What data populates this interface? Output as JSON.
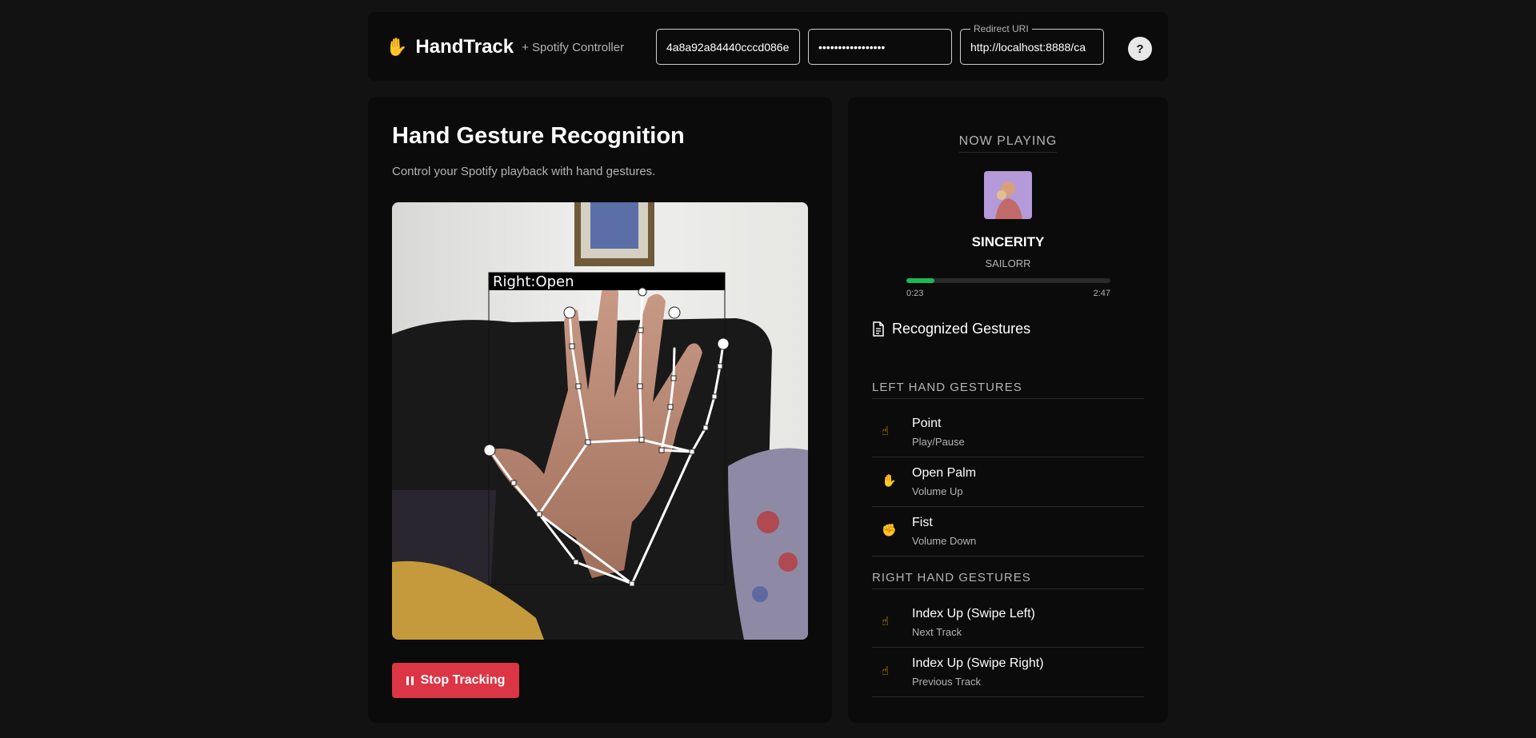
{
  "header": {
    "logo_icon": "✋",
    "title": "HandTrack",
    "subtitle": "+ Spotify Controller",
    "client_id_value": "4a8a92a84440cccd086e",
    "client_secret_value": "•••••••••••••••••",
    "redirect_label": "Redirect URI",
    "redirect_value": "http://localhost:8888/ca",
    "help_label": "?"
  },
  "main": {
    "title": "Hand Gesture Recognition",
    "description": "Control your Spotify playback with hand gestures.",
    "video_label": "Right:Open",
    "stop_button_label": "Stop Tracking"
  },
  "now_playing": {
    "heading": "NOW PLAYING",
    "track": "SINCERITY",
    "artist": "SAILORR",
    "current_time": "0:23",
    "total_time": "2:47",
    "progress_fraction": 0.138
  },
  "gestures": {
    "heading": "Recognized Gestures",
    "left_heading": "LEFT HAND GESTURES",
    "right_heading": "RIGHT HAND GESTURES",
    "left": [
      {
        "emoji": "☝",
        "name": "Point",
        "action": "Play/Pause"
      },
      {
        "emoji": "✋",
        "name": "Open Palm",
        "action": "Volume Up"
      },
      {
        "emoji": "✊",
        "name": "Fist",
        "action": "Volume Down"
      }
    ],
    "right": [
      {
        "emoji": "☝",
        "name": "Index Up (Swipe Left)",
        "action": "Next Track"
      },
      {
        "emoji": "☝",
        "name": "Index Up (Swipe Right)",
        "action": "Previous Track"
      }
    ]
  },
  "colors": {
    "accent_green": "#1db954",
    "danger_red": "#dc3545",
    "panel_bg": "#0b0b0b",
    "page_bg": "#121212"
  }
}
